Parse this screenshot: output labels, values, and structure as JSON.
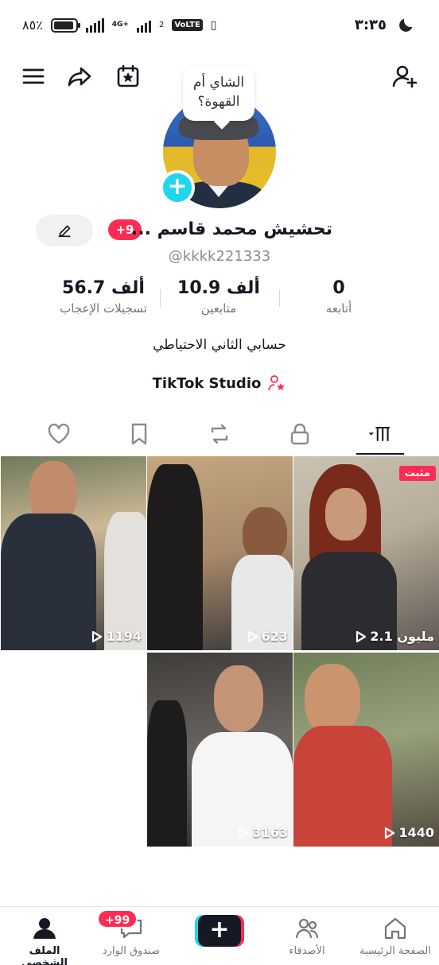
{
  "status_bar": {
    "battery": "٨٥٪",
    "network_4g": "4G+",
    "sim2": "2",
    "volte": "VoLTE",
    "time": "٣:٣٥"
  },
  "profile": {
    "bubble_text_line1": "الشاي أم",
    "bubble_text_line2": "القهوة؟",
    "display_name": "تحشيش محمد قاسم ...",
    "notif_badge": "+9",
    "handle": "@kkkk221333",
    "bio": "حسابي الثاني الاحتياطي",
    "studio_label": "TikTok Studio"
  },
  "stats": {
    "following": {
      "value": "0",
      "label": "أتابعه"
    },
    "followers": {
      "value": "10.9 ألف",
      "label": "متابعين"
    },
    "likes": {
      "value": "56.7 ألف",
      "label": "تسجيلات الإعجاب"
    }
  },
  "videos": [
    {
      "views": "2.1 مليون",
      "pinned": "مثبت"
    },
    {
      "views": "623"
    },
    {
      "views": "1194"
    },
    {
      "views": "1440"
    },
    {
      "views": "3163"
    }
  ],
  "bottom_nav": {
    "home": "الصفحة الرئيسية",
    "friends": "الأصدقاء",
    "inbox": "صندوق الوارد",
    "inbox_badge": "+99",
    "profile": "الملف الشخصي"
  },
  "colors": {
    "accent_red": "#fe2c55",
    "accent_cyan": "#20d5ec",
    "text": "#161823",
    "muted": "#73747b"
  }
}
